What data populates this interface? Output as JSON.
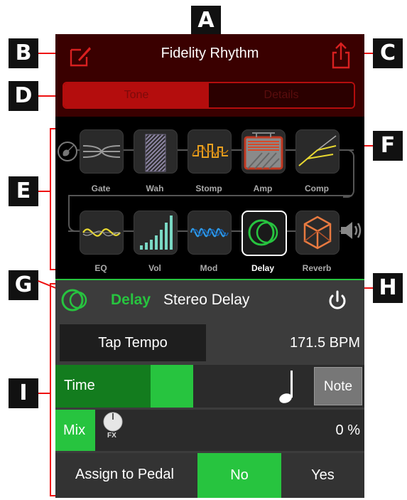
{
  "callouts": {
    "a": "A",
    "b": "B",
    "c": "C",
    "d": "D",
    "e": "E",
    "f": "F",
    "g": "G",
    "h": "H",
    "i": "I"
  },
  "header": {
    "title": "Fidelity Rhythm",
    "tab_tone": "Tone",
    "tab_details": "Details"
  },
  "chain": {
    "top": [
      {
        "label": "Gate"
      },
      {
        "label": "Wah"
      },
      {
        "label": "Stomp"
      },
      {
        "label": "Amp"
      },
      {
        "label": "Comp"
      }
    ],
    "bottom": [
      {
        "label": "EQ"
      },
      {
        "label": "Vol"
      },
      {
        "label": "Mod"
      },
      {
        "label": "Delay"
      },
      {
        "label": "Reverb"
      }
    ]
  },
  "effect": {
    "type": "Delay",
    "name": "Stereo Delay"
  },
  "tap_tempo": {
    "label": "Tap Tempo",
    "value": "171.5 BPM"
  },
  "time": {
    "label": "Time",
    "note_label": "Note",
    "fill": 0.56
  },
  "mix": {
    "label": "Mix",
    "knob_label": "FX",
    "value": "0 %"
  },
  "assign": {
    "label": "Assign to Pedal",
    "no": "No",
    "yes": "Yes",
    "selected": "No"
  },
  "colors": {
    "accent_green": "#27c43f",
    "header_red": "#b40d0d",
    "callout_line": "#e11111"
  }
}
